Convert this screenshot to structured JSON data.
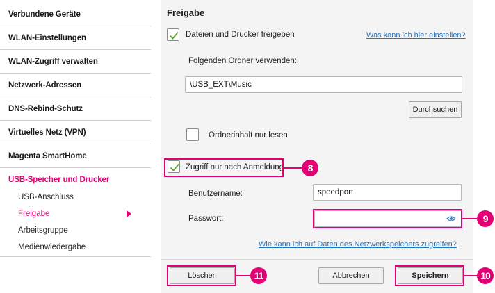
{
  "sidebar": {
    "items": [
      {
        "label": "Verbundene Geräte"
      },
      {
        "label": "WLAN-Einstellungen"
      },
      {
        "label": "WLAN-Zugriff verwalten"
      },
      {
        "label": "Netzwerk-Adressen"
      },
      {
        "label": "DNS-Rebind-Schutz"
      },
      {
        "label": "Virtuelles Netz (VPN)"
      },
      {
        "label": "Magenta SmartHome"
      },
      {
        "label": "USB-Speicher und Drucker"
      }
    ],
    "subitems": [
      {
        "label": "USB-Anschluss"
      },
      {
        "label": "Freigabe"
      },
      {
        "label": "Arbeitsgruppe"
      },
      {
        "label": "Medienwiedergabe"
      }
    ]
  },
  "main": {
    "title": "Freigabe",
    "share_checkbox_label": "Dateien und Drucker freigeben",
    "share_checked": true,
    "help_link": "Was kann ich hier einstellen?",
    "folder_label": "Folgenden Ordner verwenden:",
    "folder_value": "\\USB_EXT\\Music",
    "browse_button": "Durchsuchen",
    "readonly_label": "Ordnerinhalt nur lesen",
    "readonly_checked": false,
    "login_checkbox_label": "Zugriff nur nach Anmeldung",
    "login_checked": true,
    "username_label": "Benutzername:",
    "username_value": "speedport",
    "password_label": "Passwort:",
    "password_value": "",
    "access_link": "Wie kann ich auf Daten des Netzwerkspeichers zugreifen?",
    "delete_button": "Löschen",
    "cancel_button": "Abbrechen",
    "save_button": "Speichern"
  },
  "callouts": {
    "login": "8",
    "password": "9",
    "save": "10",
    "delete": "11"
  },
  "colors": {
    "accent": "#e20074",
    "check": "#5aa02c",
    "link": "#2a74b8",
    "panel_bg": "#f4f4f4"
  }
}
